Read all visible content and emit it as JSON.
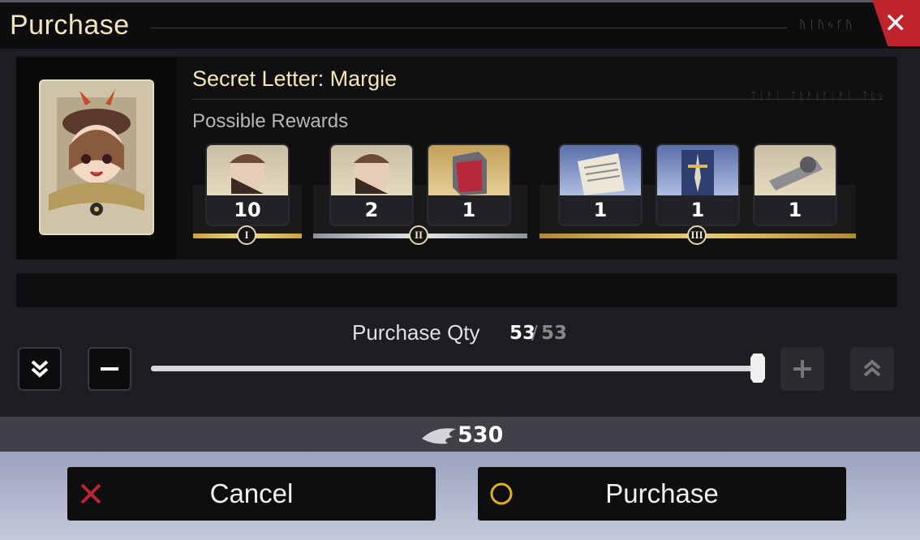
{
  "header": {
    "title": "Purchase",
    "rune_text": "ᚢᛁᚢᛃᚴᚢ",
    "close_label": "✕"
  },
  "item": {
    "name": "Secret Letter: Margie",
    "rune_text": "ᛏᛁᚠᛁ ᛏᚱᚨᚾᚴᛁᚠᛁ ᛏᚱᛟ",
    "rewards_label": "Possible Rewards",
    "tiers": [
      {
        "badge": "I",
        "rewards": [
          {
            "icon": "margie-shard",
            "count": "10"
          }
        ]
      },
      {
        "badge": "II",
        "rewards": [
          {
            "icon": "margie-shard",
            "count": "2"
          },
          {
            "icon": "red-cube",
            "count": "1"
          }
        ]
      },
      {
        "badge": "III",
        "rewards": [
          {
            "icon": "document-scroll",
            "count": "1"
          },
          {
            "icon": "dagger-card",
            "count": "1"
          },
          {
            "icon": "metal-scroll",
            "count": "1"
          }
        ]
      }
    ]
  },
  "quantity": {
    "label": "Purchase Qty",
    "current": "53",
    "separator": "/",
    "max": "53",
    "fill": 1.0
  },
  "cost": {
    "icon": "feather-currency-icon",
    "amount": "530"
  },
  "buttons": {
    "cancel": "Cancel",
    "purchase": "Purchase"
  },
  "colors": {
    "accent_red": "#c0232b",
    "gold": "#f5e6b8",
    "purchase_ring": "#e0b020"
  }
}
